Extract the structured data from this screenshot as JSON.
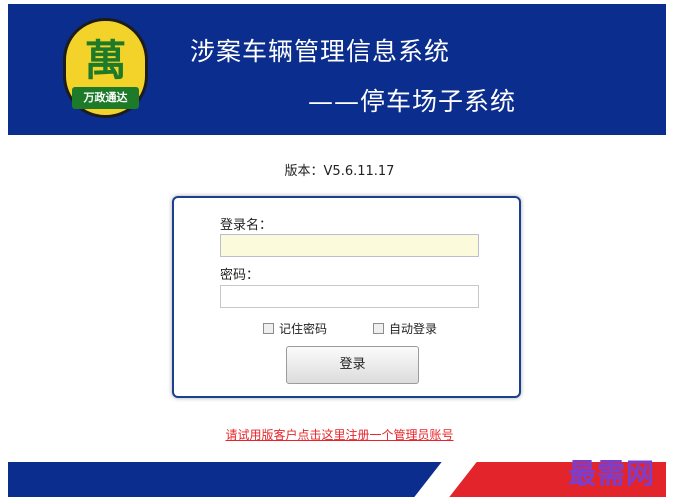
{
  "header": {
    "logo_char": "萬",
    "logo_band_text": "万政通达",
    "title_line1": "涉案车辆管理信息系统",
    "title_line2": "——停车场子系统"
  },
  "version_text": "版本：V5.6.11.17",
  "login": {
    "username_label": "登录名：",
    "username_value": "",
    "password_label": "密码：",
    "password_value": "",
    "remember_password_label": "记住密码",
    "auto_login_label": "自动登录",
    "submit_label": "登录"
  },
  "trial_link_text": "请试用版客户点击这里注册一个管理员账号",
  "watermark_text": "最需网",
  "colors": {
    "header_blue": "#0b2d8e",
    "footer_red": "#e3242b",
    "link_red": "#e8242a",
    "logo_yellow": "#f3d22a",
    "logo_green": "#1d7a28"
  }
}
